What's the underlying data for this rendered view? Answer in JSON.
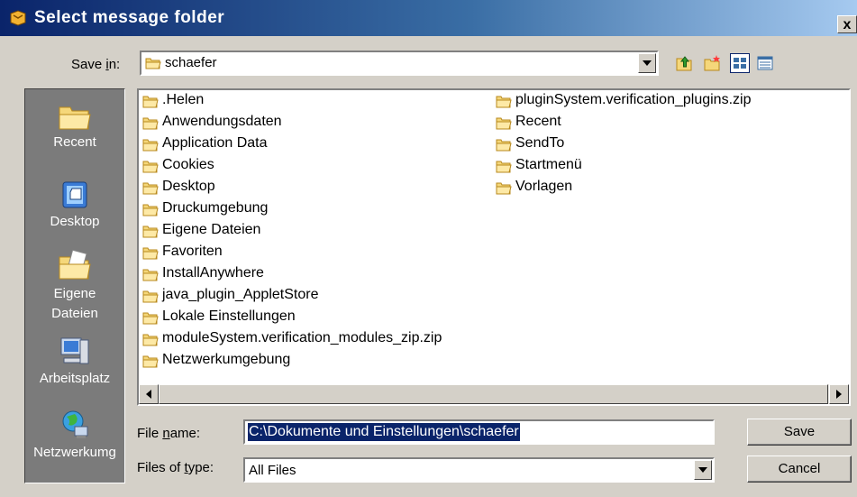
{
  "window": {
    "title": "Select message folder",
    "close_label": "x"
  },
  "save_in": {
    "label_pre": "Save ",
    "label_key": "i",
    "label_post": "n:",
    "value": "schaefer"
  },
  "toolbar": {
    "icons": [
      "up-one-level-icon",
      "create-new-folder-icon",
      "list-view-icon",
      "details-view-icon"
    ],
    "active_view": "list-view-icon"
  },
  "places": [
    {
      "label": "Recent",
      "icon": "recent-folder-icon"
    },
    {
      "label": "Desktop",
      "icon": "desktop-icon"
    },
    {
      "label": "Eigene Dateien",
      "icon": "my-documents-icon"
    },
    {
      "label": "Arbeitsplatz",
      "icon": "my-computer-icon"
    },
    {
      "label": "Netzwerkumg",
      "icon": "network-icon"
    }
  ],
  "files": {
    "column1": [
      ".Helen",
      "Anwendungsdaten",
      "Application Data",
      "Cookies",
      "Desktop",
      "Druckumgebung",
      "Eigene Dateien",
      "Favoriten",
      "InstallAnywhere",
      "java_plugin_AppletStore",
      "Lokale Einstellungen",
      "moduleSystem.verification_modules_zip.zip",
      "Netzwerkumgebung"
    ],
    "column2": [
      "pluginSystem.verification_plugins.zip",
      "Recent",
      "SendTo",
      "Startmenü",
      "Vorlagen"
    ]
  },
  "form": {
    "file_name_label_pre": "File ",
    "file_name_label_key": "n",
    "file_name_label_post": "ame:",
    "file_name_value": "C:\\Dokumente und Einstellungen\\schaefer",
    "files_of_type_label_pre": "Files of ",
    "files_of_type_label_key": "t",
    "files_of_type_label_post": "ype:",
    "files_of_type_value": "All Files"
  },
  "buttons": {
    "save": "Save",
    "cancel": "Cancel"
  },
  "colors": {
    "title_start": "#0a246a",
    "title_end": "#a6caf0",
    "dialog_bg": "#d4d0c8",
    "places_bg": "#7b7b7b",
    "selection": "#0a246a",
    "folder": "#f5d77a"
  }
}
